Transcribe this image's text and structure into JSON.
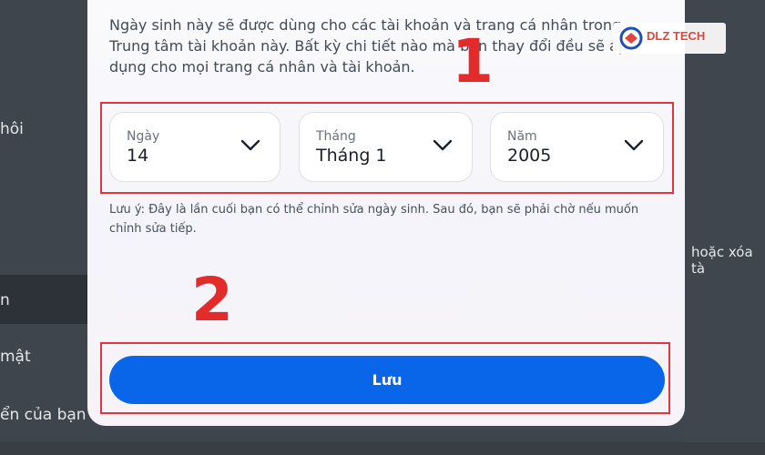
{
  "background": {
    "side_items": [
      "hôi",
      "n",
      "mật",
      "ển của bạn"
    ],
    "right_text": "hoặc xóa tà"
  },
  "modal": {
    "description": "Ngày sinh này sẽ được dùng cho các tài khoản và trang cá nhân trong Trung tâm tài khoản này. Bất kỳ chi tiết nào mà bạn thay đổi đều sẽ áp dụng cho mọi trang cá nhân và tài khoản.",
    "selects": [
      {
        "label": "Ngày",
        "value": "14",
        "icon": "chevron-down-icon"
      },
      {
        "label": "Tháng",
        "value": "Tháng 1",
        "icon": "chevron-down-icon"
      },
      {
        "label": "Năm",
        "value": "2005",
        "icon": "chevron-down-icon"
      }
    ],
    "note": "Lưu ý: Đây là lần cuối bạn có thể chỉnh sửa ngày sinh. Sau đó, bạn sẽ phải chờ nếu muốn chỉnh sửa tiếp.",
    "save_label": "Lưu"
  },
  "annotations": {
    "step1": "1",
    "step2": "2",
    "color": "#e32b2b"
  },
  "logo": {
    "text": "DLZ TECH"
  },
  "colors": {
    "accent": "#0a66e8",
    "highlight_box": "#e0363d",
    "backdrop": "#3f454d"
  }
}
